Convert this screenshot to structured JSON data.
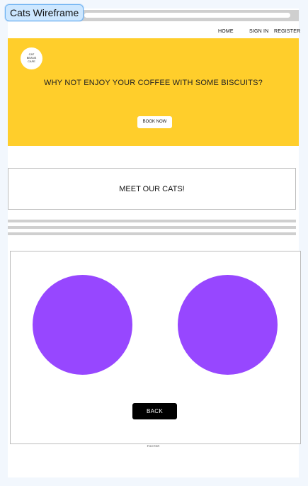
{
  "frame": {
    "title": "Cats Wireframe"
  },
  "nav": {
    "home": "HOME",
    "sign_in": "SIGN IN",
    "register": "REGISTER"
  },
  "hero": {
    "logo_text": "CAT\nBEANS\nCAFE",
    "heading": "WHY NOT ENJOY YOUR COFFEE WITH SOME BISCUITS?",
    "book_button": "BOOK NOW"
  },
  "meet": {
    "label": "MEET OUR CATS!"
  },
  "cats": {
    "back_button": "BACK"
  },
  "footer": {
    "text": "FOOTER"
  },
  "colors": {
    "hero_bg": "#ffce2b",
    "cat_circle": "#9747ff",
    "button_dark": "#000000",
    "placeholder_gray": "#cfcfcf"
  }
}
